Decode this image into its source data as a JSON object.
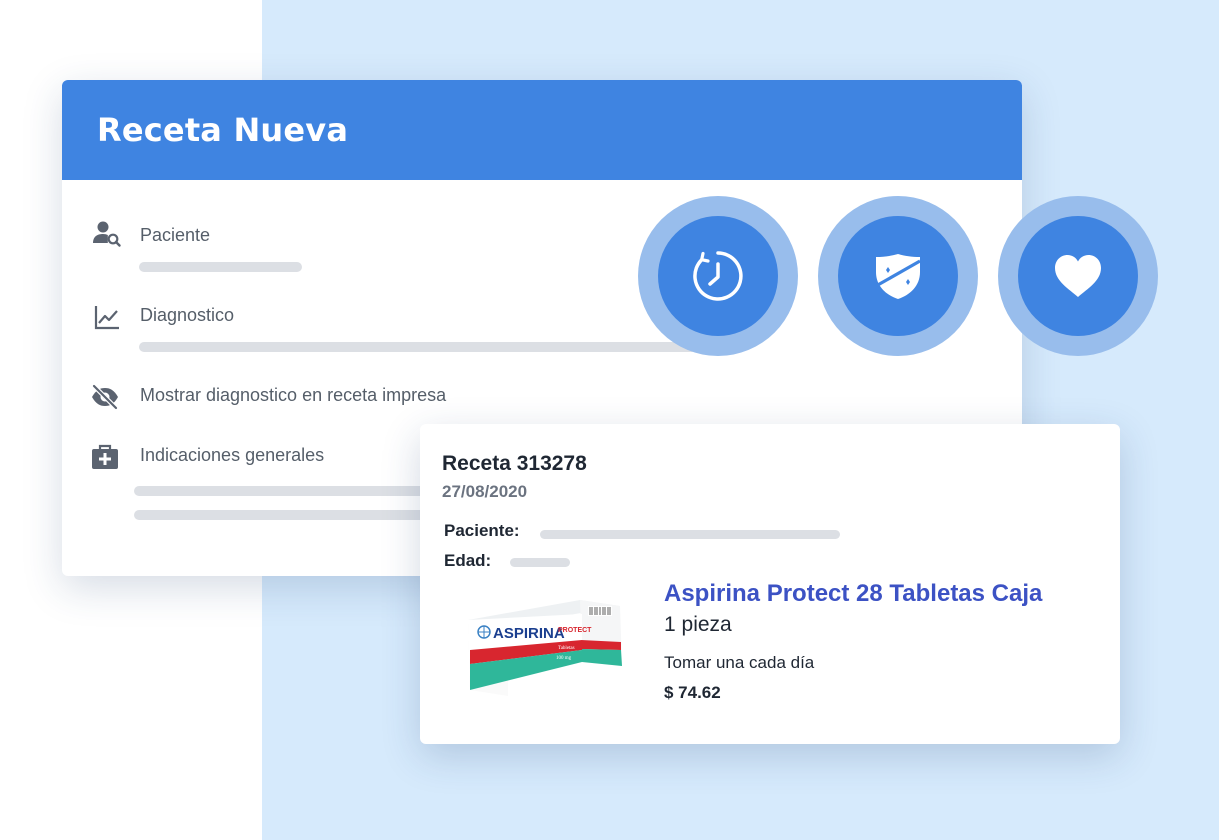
{
  "colors": {
    "accent": "#3f84e1",
    "accent_light": "#98bdec",
    "background_panel": "#d6eafc",
    "product_link": "#3c52c4",
    "placeholder_bar": "#dcdfe4"
  },
  "form": {
    "title": "Receta Nueva",
    "fields": [
      {
        "icon": "patient-search-icon",
        "label": "Paciente"
      },
      {
        "icon": "chart-line-icon",
        "label": "Diagnostico"
      },
      {
        "icon": "eye-off-icon",
        "label": "Mostrar diagnostico en receta impresa"
      },
      {
        "icon": "medical-kit-icon",
        "label": "Indicaciones generales"
      }
    ]
  },
  "features": [
    {
      "icon": "timer-icon"
    },
    {
      "icon": "shield-icon"
    },
    {
      "icon": "heart-icon"
    }
  ],
  "prescription": {
    "title": "Receta 313278",
    "date": "27/08/2020",
    "patient_label": "Paciente:",
    "age_label": "Edad:",
    "product": {
      "image_icon": "medicine-box-image",
      "box_brand": "ASPIRINA",
      "box_variant": "PROTECT",
      "box_sub": "Tabletas",
      "box_dose": "100 mg",
      "name": "Aspirina Protect 28 Tabletas Caja",
      "quantity": "1 pieza",
      "instructions": "Tomar una cada día",
      "price": "$ 74.62"
    }
  }
}
